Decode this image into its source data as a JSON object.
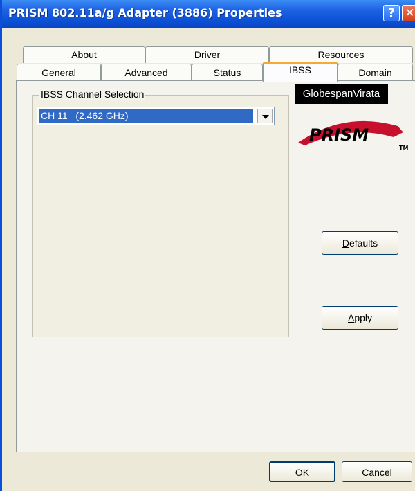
{
  "window": {
    "title": "PRISM 802.11a/g Adapter (3886) Properties",
    "help_glyph": "?",
    "close_glyph": "✕"
  },
  "tabs_row1": [
    {
      "label": "About"
    },
    {
      "label": "Driver"
    },
    {
      "label": "Resources"
    }
  ],
  "tabs_row2": [
    {
      "label": "General"
    },
    {
      "label": "Advanced"
    },
    {
      "label": "Status"
    },
    {
      "label": "IBSS",
      "active": true
    },
    {
      "label": "Domain"
    }
  ],
  "ibss": {
    "group_label": "IBSS Channel Selection",
    "channel_value": "CH 11   (2.462 GHz)"
  },
  "logos": {
    "vendor": "GlobespanVirata",
    "brand": "PRISM",
    "trademark": "TM"
  },
  "buttons": {
    "defaults": "Defaults",
    "defaults_mnemonic": "D",
    "apply": "Apply",
    "apply_mnemonic": "A",
    "ok": "OK",
    "cancel": "Cancel"
  },
  "colors": {
    "titlebar": "#0a4fd8",
    "active_tab_accent": "#f6a833",
    "selection": "#316ac5",
    "brand_red": "#c8102e"
  }
}
